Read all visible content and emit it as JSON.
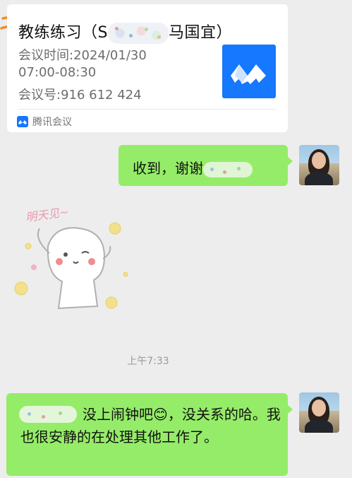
{
  "card": {
    "title_prefix": "教练练习（S",
    "title_suffix": "马国宜）",
    "time_line1": "会议时间:2024/01/30",
    "time_line2": "07:00-08:30",
    "meeting_id": "会议号:916 612 424",
    "app_name": "腾讯会议"
  },
  "messages": {
    "reply1": "收到，谢谢",
    "sticker_text": "明天见~",
    "timestamp": "上午7:33",
    "reply2": "没上闹钟吧😊，没关系的哈。我也很安静的在处理其他工作了。"
  },
  "colors": {
    "bubble": "#95ec69",
    "background": "#ededed",
    "brand": "#1677ff",
    "annotation": "#f28c28"
  }
}
